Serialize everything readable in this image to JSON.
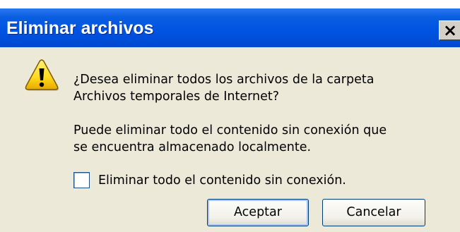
{
  "dialog": {
    "title": "Eliminar archivos",
    "close_glyph": "×",
    "icon": "warning-icon",
    "question_line1": "¿Desea eliminar todos los archivos de la carpeta",
    "question_line2": "Archivos temporales de Internet?",
    "info_line1": "Puede eliminar todo el contenido sin conexión que",
    "info_line2": "se encuentra almacenado localmente.",
    "checkbox_label": "Eliminar todo el contenido sin conexión.",
    "checkbox_checked": false,
    "ok_label": "Aceptar",
    "cancel_label": "Cancelar"
  },
  "colors": {
    "titlebar": "#0054e3",
    "dialog_background": "#ece9d8",
    "warning_fill": "#ffd81c",
    "button_border": "#003c74"
  }
}
